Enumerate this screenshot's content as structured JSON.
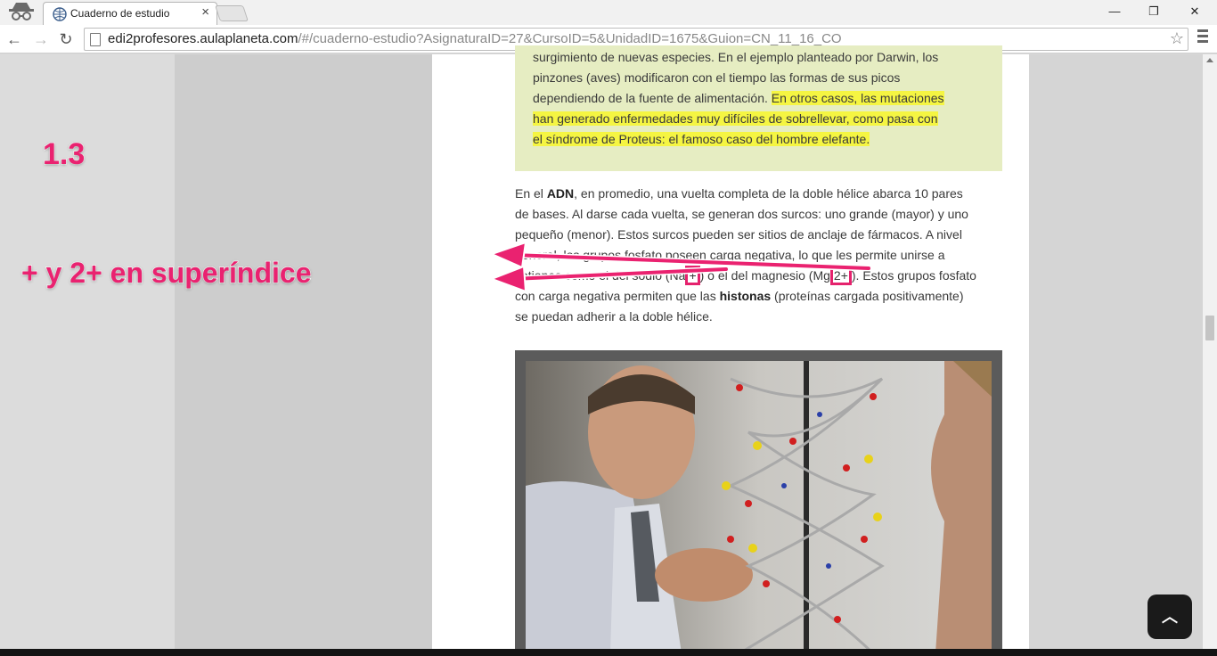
{
  "browser": {
    "tab_title": "Cuaderno de estudio",
    "tab_close": "×",
    "url_host": "edi2profesores.aulaplaneta.com",
    "url_rest": "/#/cuaderno-estudio?AsignaturaID=27&CursoID=5&UnidadID=1675&Guion=CN_11_16_CO",
    "minimize": "—",
    "restore": "❐",
    "close": "✕",
    "back": "←",
    "forward": "→",
    "reload": "↻",
    "star": "☆"
  },
  "note": {
    "line1": "surgimiento de nuevas especies. En el ejemplo planteado por Darwin, los",
    "line2": "pinzones (aves) modificaron con el tiempo las formas de sus picos",
    "line3_plain": "dependiendo de la fuente de alimentación. ",
    "line3_hl": "En otros casos, las mutaciones",
    "line4_hl": "han generado enfermedades muy difíciles de sobrellevar, como pasa con",
    "line5_hl": "el síndrome de Proteus: el famoso caso del hombre elefante."
  },
  "paragraph": {
    "p1": "En el ",
    "adn": "ADN",
    "p2": ", en promedio, una vuelta completa de la doble hélice abarca 10 pares de bases. Al darse cada vuelta, se generan dos surcos: uno grande (mayor) y uno pequeño (menor). Estos surcos pueden ser sitios de anclaje de fármacos. A nivel general, los grupos fosfato poseen carga negativa, lo que les permite unirse a cationes como el del sodio (Na",
    "na_charge": "+",
    "p3": ") o el del magnesio (Mg",
    "mg_charge": "2+",
    "p4": "). Estos grupos fosfato con carga negativa permiten que las ",
    "histonas": "histonas",
    "p5": " (proteínas cargada positivamente) se puedan adherir a la doble hélice."
  },
  "annotations": {
    "label_1": "1.3",
    "label_2": "+ y 2+ en superíndice"
  },
  "back_to_top": "︿",
  "icons": {
    "incognito": "incognito-icon",
    "favicon": "globe-icon",
    "menu": "hamburger-icon"
  },
  "colors": {
    "annotation": "#ea2270",
    "note_bg": "#e6edc2",
    "highlight": "#f5f542"
  }
}
